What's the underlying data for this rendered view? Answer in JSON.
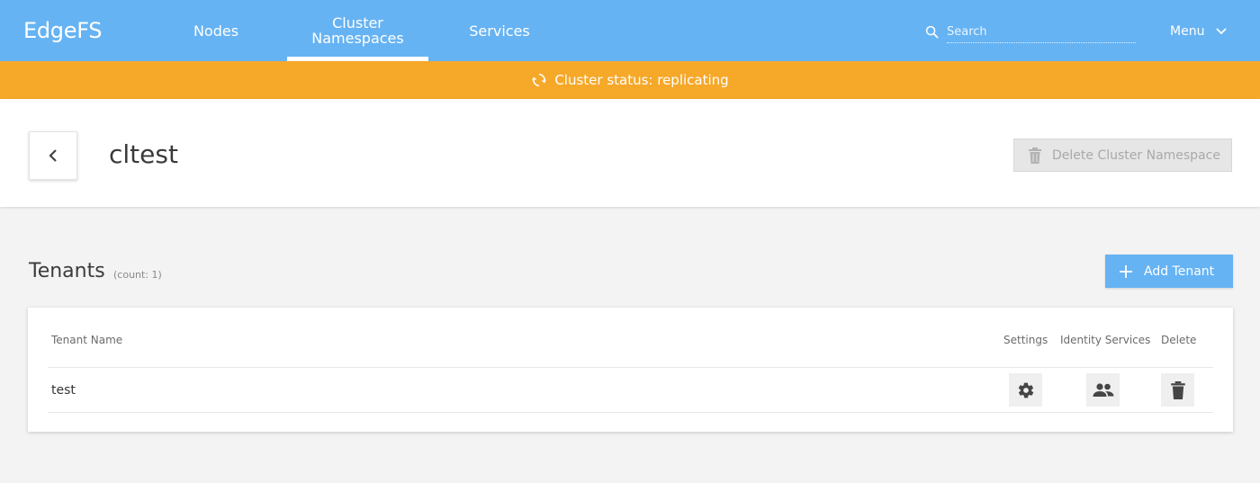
{
  "app": {
    "brand": "EdgeFS"
  },
  "nav": {
    "items": [
      {
        "label": "Nodes"
      },
      {
        "label_line1": "Cluster",
        "label_line2": "Namespaces",
        "active": true
      },
      {
        "label": "Services"
      }
    ]
  },
  "search": {
    "placeholder": "Search",
    "value": ""
  },
  "menu": {
    "label": "Menu"
  },
  "status": {
    "text": "Cluster status: replicating",
    "color": "#f6a829"
  },
  "header": {
    "title": "cltest",
    "delete_label": "Delete Cluster Namespace",
    "delete_disabled": true
  },
  "tenants": {
    "title": "Tenants",
    "count_text": "(count: 1)",
    "add_label": "Add Tenant",
    "columns": [
      "Tenant Name",
      "Settings",
      "Identity Services",
      "Delete"
    ],
    "rows": [
      {
        "name": "test"
      }
    ]
  },
  "colors": {
    "accent": "#66b3f3",
    "warning": "#f6a829"
  },
  "icons": [
    "search-icon",
    "chevron-down-icon",
    "sync-icon",
    "chevron-left-icon",
    "trash-icon",
    "plus-icon",
    "gear-icon",
    "people-icon"
  ]
}
